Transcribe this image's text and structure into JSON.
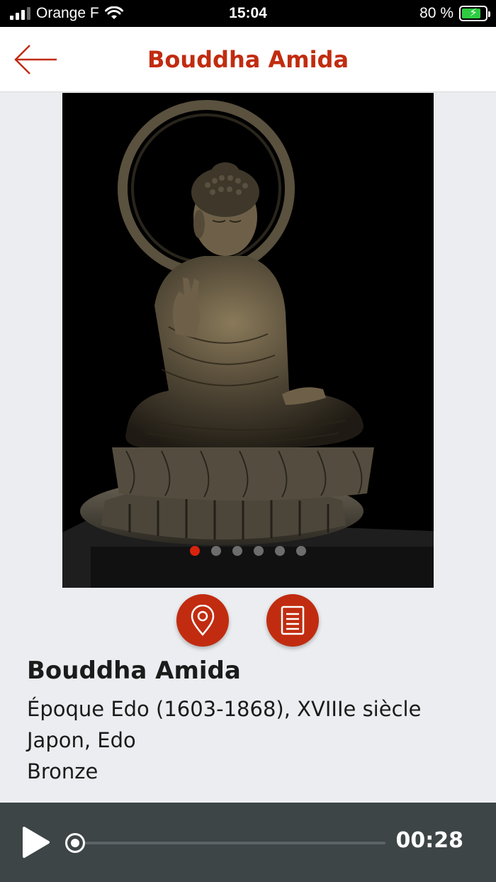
{
  "status_bar": {
    "carrier": "Orange F",
    "time": "15:04",
    "battery": "80 %",
    "battery_level": 0.8
  },
  "header": {
    "title": "Bouddha Amida",
    "back_icon": "arrow-left-icon"
  },
  "carousel": {
    "image_description": "bronze-seated-buddha-photo",
    "slide_count": 6,
    "active_index": 0
  },
  "actions": [
    {
      "name": "location",
      "icon": "map-pin-icon"
    },
    {
      "name": "details",
      "icon": "document-icon"
    }
  ],
  "info": {
    "title": "Bouddha Amida",
    "period": "Époque Edo (1603-1868), XVIIIe siècle",
    "origin": "Japon, Edo",
    "material": "Bronze"
  },
  "player": {
    "play_icon": "play-icon",
    "elapsed": "00:28",
    "progress": 0.0
  },
  "colors": {
    "accent": "#c12c10",
    "player_bg": "#3e4547",
    "page_bg": "#ebedf0"
  }
}
